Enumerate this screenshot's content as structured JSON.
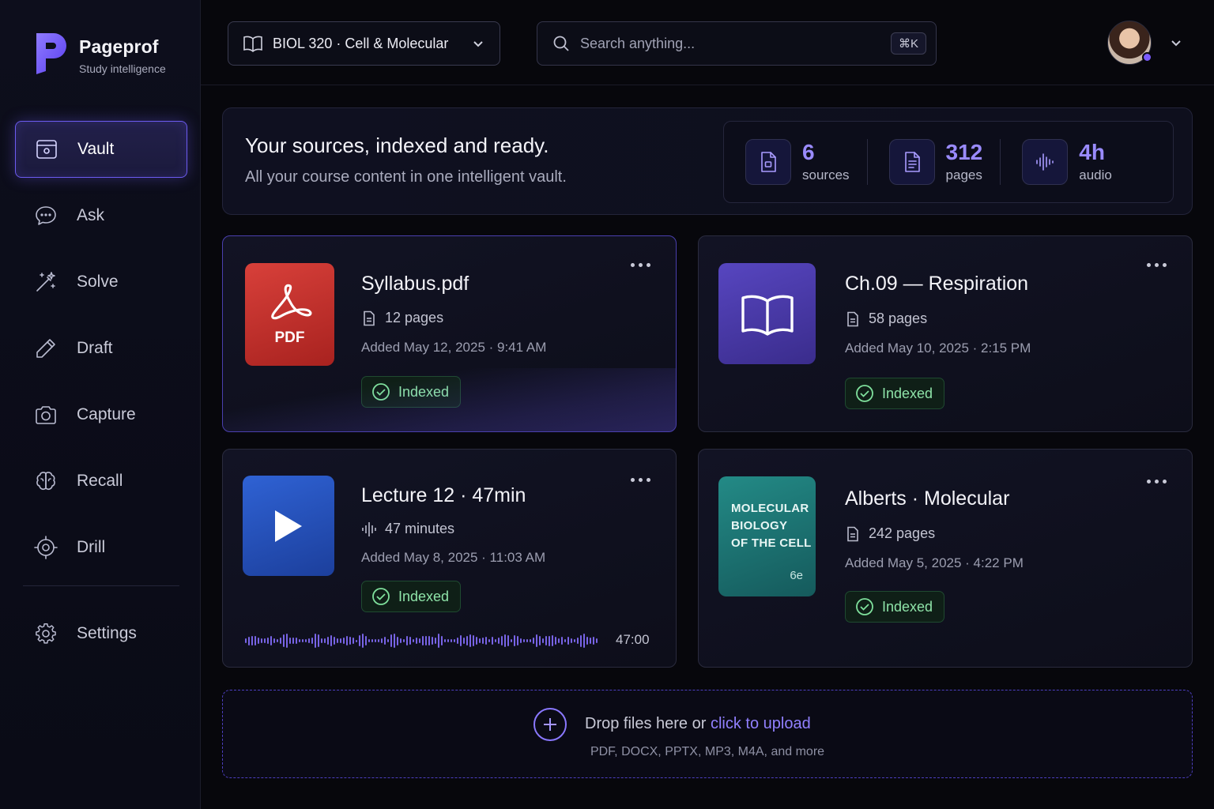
{
  "brand": {
    "name": "Pageprof",
    "tagline": "Study intelligence"
  },
  "nav": {
    "items": [
      {
        "label": "Vault",
        "icon": "vault-icon",
        "active": true
      },
      {
        "label": "Ask",
        "icon": "chat-icon"
      },
      {
        "label": "Solve",
        "icon": "magic-wand-icon"
      },
      {
        "label": "Draft",
        "icon": "pencil-icon"
      },
      {
        "label": "Capture",
        "icon": "camera-icon"
      },
      {
        "label": "Recall",
        "icon": "brain-icon"
      },
      {
        "label": "Drill",
        "icon": "target-icon"
      }
    ],
    "settings": {
      "label": "Settings",
      "icon": "gear-icon"
    }
  },
  "topbar": {
    "course": "BIOL 320 · Cell & Molecular",
    "search_placeholder": "Search anything...",
    "search_shortcut": "⌘K"
  },
  "hero": {
    "title": "Your sources, indexed and ready.",
    "subtitle": "All your course content in one intelligent vault.",
    "stats": [
      {
        "value": "6",
        "label": "sources",
        "icon": "document-icon"
      },
      {
        "value": "312",
        "label": "pages",
        "icon": "document-text-icon"
      },
      {
        "value": "4h",
        "label": "audio",
        "icon": "audio-wave-icon"
      }
    ]
  },
  "sources": [
    {
      "title": "Syllabus.pdf",
      "meta": "12 pages",
      "added": "Added May 12, 2025 · 9:41 AM",
      "status": "Indexed",
      "thumb_label": "PDF"
    },
    {
      "title": "Ch.09 — Respiration",
      "meta": "58 pages",
      "added": "Added May 10, 2025 · 2:15 PM",
      "status": "Indexed"
    },
    {
      "title": "Lecture 12 · 47min",
      "meta": "47 minutes",
      "added": "Added May 8, 2025 · 11:03 AM",
      "status": "Indexed",
      "duration": "47:00"
    },
    {
      "title": "Alberts · Molecular",
      "meta": "242 pages",
      "added": "Added May 5, 2025 · 4:22 PM",
      "status": "Indexed",
      "cover": {
        "line1": "MOLECULAR",
        "line2": "BIOLOGY",
        "line3": "OF THE CELL",
        "edition": "6e"
      }
    }
  ],
  "dropzone": {
    "text": "Drop files here or",
    "link": "click to upload",
    "formats": "PDF, DOCX, PPTX, MP3, M4A, and more"
  },
  "colors": {
    "accent": "#7c5cff",
    "indexed": "#7fe09c",
    "pdf_red": "#c8302c",
    "book_purple": "#4a3aa6",
    "video_blue": "#2452b8",
    "cover_teal": "#1e7a7a"
  }
}
